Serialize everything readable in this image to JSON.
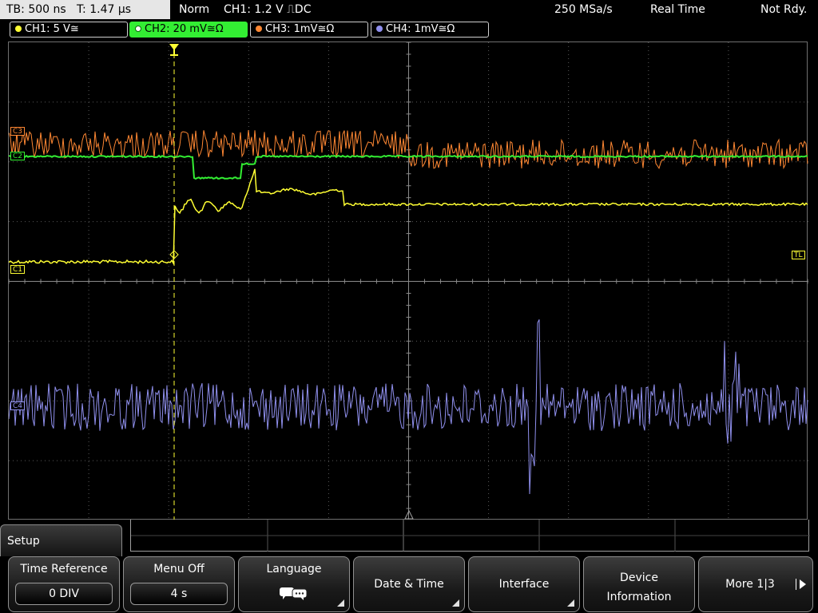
{
  "status": {
    "timebase": "TB: 500 ns",
    "time_pos": "T: 1.47 µs",
    "trigger_mode": "Norm",
    "trigger_info": "CH1: 1.2 V ⎍DC",
    "sample_rate": "250 MSa/s",
    "acq_mode": "Real Time",
    "trigger_state": "Not Rdy."
  },
  "channels": [
    {
      "label": "CH1: 5 V≅",
      "color": "#ffff33"
    },
    {
      "label": "CH2: 20 mV≅Ω",
      "color": "#33ee33"
    },
    {
      "label": "CH3: 1mV≅Ω",
      "color": "#ff8833"
    },
    {
      "label": "CH4: 1mV≅Ω",
      "color": "#9090ee"
    }
  ],
  "markers": {
    "ch1": "C1",
    "ch2": "C2",
    "ch3": "C3",
    "ch4": "C4",
    "trigger_level": "TL"
  },
  "menu": {
    "title": "Setup",
    "keys": [
      {
        "title": "Time Reference",
        "value": "0 DIV"
      },
      {
        "title": "Menu Off",
        "value": "4 s"
      },
      {
        "title": "Language",
        "icon": "speech-bubbles-icon"
      },
      {
        "title": "Date & Time"
      },
      {
        "title": "Interface"
      },
      {
        "title_line1": "Device",
        "title_line2": "Information"
      },
      {
        "title": "More 1|3"
      }
    ]
  },
  "colors": {
    "ch1": "#ffff33",
    "ch2": "#33ee33",
    "ch3": "#ff8833",
    "ch4": "#9090ee",
    "grid": "#5a5a5a"
  }
}
